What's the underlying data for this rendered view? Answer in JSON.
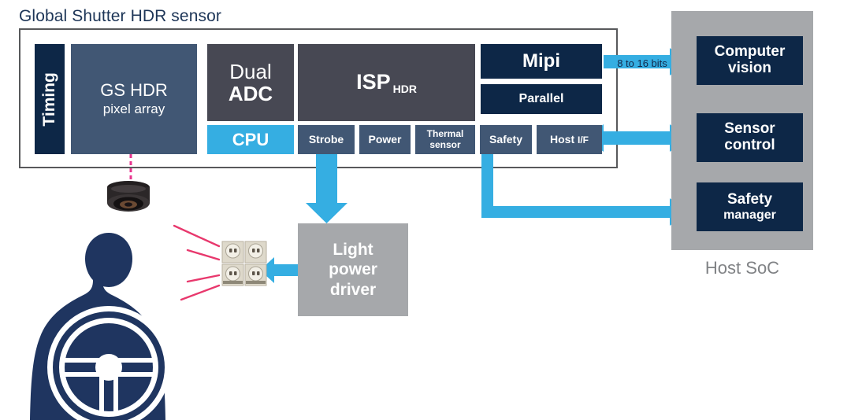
{
  "diagram": {
    "title": "Global Shutter HDR sensor",
    "type": "block-diagram",
    "colors": {
      "navy": "#0d2747",
      "slate_blue": "#415774",
      "charcoal": "#474853",
      "cyan": "#35aee2",
      "grey": "#a6a8ab",
      "title_text": "#1d3557",
      "pink": "#e8368f",
      "magenta_rays": "#e8386d"
    }
  },
  "sensor": {
    "timing": {
      "label": "Timing"
    },
    "pixel_array": {
      "line1": "GS HDR",
      "line2": "pixel array"
    },
    "dual_adc": {
      "line1": "Dual",
      "line2": "ADC"
    },
    "cpu": {
      "label": "CPU"
    },
    "isp": {
      "label": "ISP",
      "subscript": "HDR"
    },
    "mipi": {
      "label": "Mipi"
    },
    "parallel": {
      "label": "Parallel"
    },
    "small_blocks": [
      {
        "label": "Strobe"
      },
      {
        "label": "Power"
      },
      {
        "label": "Thermal",
        "label2": "sensor"
      },
      {
        "label": "Safety"
      },
      {
        "label": "Host ",
        "label_small": "I/F"
      }
    ]
  },
  "host_soc": {
    "label": "Host SoC",
    "blocks": [
      {
        "line1": "Computer",
        "line2": "vision"
      },
      {
        "line1": "Sensor",
        "line2": "control"
      },
      {
        "line1": "Safety",
        "line2": "manager"
      }
    ]
  },
  "light_power_driver": {
    "line1": "Light",
    "line2": "power",
    "line3": "driver"
  },
  "connections": {
    "mipi_to_cv_label": "8 to 16 bits",
    "hostif_to_sensor_control": "bidirectional",
    "safety_to_safety_manager": "elbow-down-right",
    "strobe_to_light_driver": "down",
    "light_driver_to_led": "left",
    "pixel_array_to_camera": "dashed"
  },
  "icons": {
    "camera": "camera-lens-icon",
    "led": "led-array-icon",
    "driver": "driver-at-steering-wheel-icon",
    "rays": "ir-illumination-rays"
  }
}
